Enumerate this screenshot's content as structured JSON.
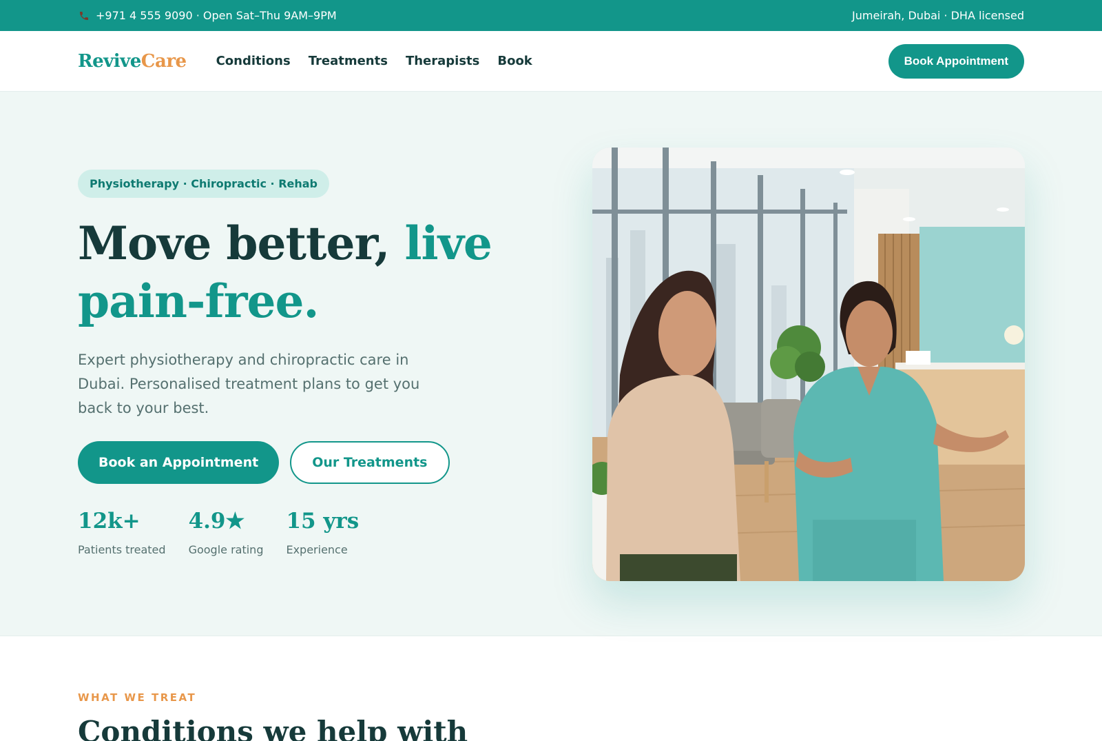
{
  "topbar": {
    "phone_icon": "phone-icon",
    "contact": "+971 4 555 9090 · Open Sat–Thu 9AM–9PM",
    "location": "Jumeirah, Dubai · DHA licensed"
  },
  "nav": {
    "logo_part1": "Revive",
    "logo_part2": "Care",
    "links": [
      "Conditions",
      "Treatments",
      "Therapists",
      "Book"
    ],
    "cta": "Book Appointment"
  },
  "hero": {
    "badge": "Physiotherapy · Chiropractic · Rehab",
    "headline_plain": "Move better, ",
    "headline_accent": "live pain-free.",
    "description": "Expert physiotherapy and chiropractic care in Dubai. Personalised treatment plans to get you back to your best.",
    "primary_cta": "Book an Appointment",
    "secondary_cta": "Our Treatments",
    "stats": [
      {
        "value": "12k+",
        "label": "Patients treated"
      },
      {
        "value": "4.9★",
        "label": "Google rating"
      },
      {
        "value": "15 yrs",
        "label": "Experience"
      }
    ]
  },
  "treat": {
    "eyebrow": "WHAT WE TREAT",
    "title": "Conditions we help with"
  },
  "colors": {
    "brand": "#12968a",
    "accent": "#e8974a",
    "ink": "#163a3a",
    "hero_bg": "#eff7f5"
  }
}
